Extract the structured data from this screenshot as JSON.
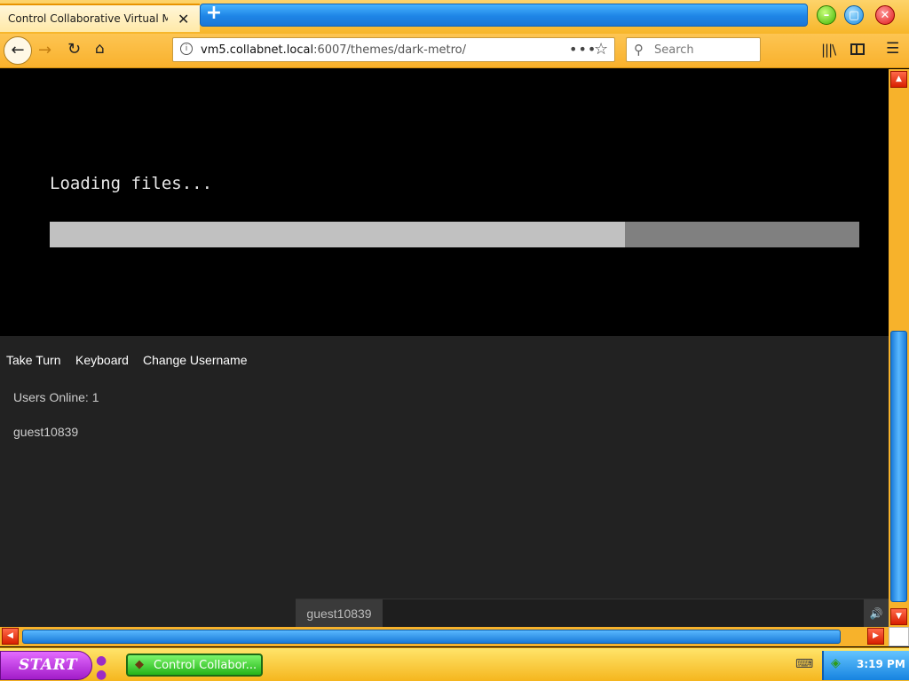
{
  "browser": {
    "tab_title": "Control Collaborative Virtual Ma",
    "tab_close": "✕",
    "new_tab": "+",
    "window_buttons": {
      "minimize": "–",
      "maximize": "▢",
      "close": "✕"
    },
    "nav": {
      "back": "←",
      "forward": "→",
      "reload": "↻",
      "home": "⌂"
    },
    "url": {
      "host": "vm5.collabnet.local",
      "rest": ":6007/themes/dark-metro/"
    },
    "url_more": "•••",
    "bookmark": "☆",
    "search_placeholder": "Search",
    "icons": {
      "library": "|||\\",
      "menu": "☰",
      "search": "⚲"
    }
  },
  "display": {
    "loading_text": "Loading files...",
    "progress": 0.71
  },
  "panel": {
    "menu": [
      "Take Turn",
      "Keyboard",
      "Change Username"
    ],
    "users_online": "Users Online: 1",
    "users": [
      "guest10839"
    ],
    "chat_username": "guest10839",
    "sound_icon": "🔊"
  },
  "scrollbars": {
    "up": "▲",
    "down": "▼",
    "left": "◀",
    "right": "▶"
  },
  "taskbar": {
    "start_label": "START",
    "task_label": "Control Collabor...",
    "clock": "3:19 PM"
  },
  "colors": {
    "accent_orange": "#f7b22b",
    "scroll_blue": "#1a7ad8",
    "start_purple": "#a21cc9",
    "task_green": "#24b319"
  }
}
